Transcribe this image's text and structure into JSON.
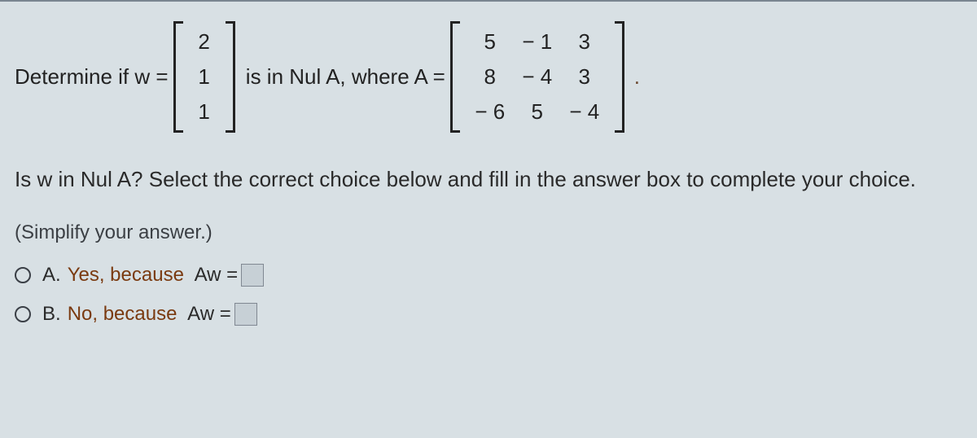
{
  "problem": {
    "lead": "Determine if w =",
    "w": [
      "2",
      "1",
      "1"
    ],
    "mid": " is in Nul A, where A =",
    "A": [
      [
        "5",
        "− 1",
        "3"
      ],
      [
        "8",
        "− 4",
        "3"
      ],
      [
        "− 6",
        "5",
        "− 4"
      ]
    ],
    "trail": "."
  },
  "question": "Is w in Nul A? Select the correct choice below and fill in the answer box to complete your choice.",
  "hint": "(Simplify your answer.)",
  "choices": {
    "a": {
      "letter": "A.",
      "label": "Yes, because",
      "expr": "Aw ="
    },
    "b": {
      "letter": "B.",
      "label": "No, because",
      "expr": "Aw ="
    }
  }
}
